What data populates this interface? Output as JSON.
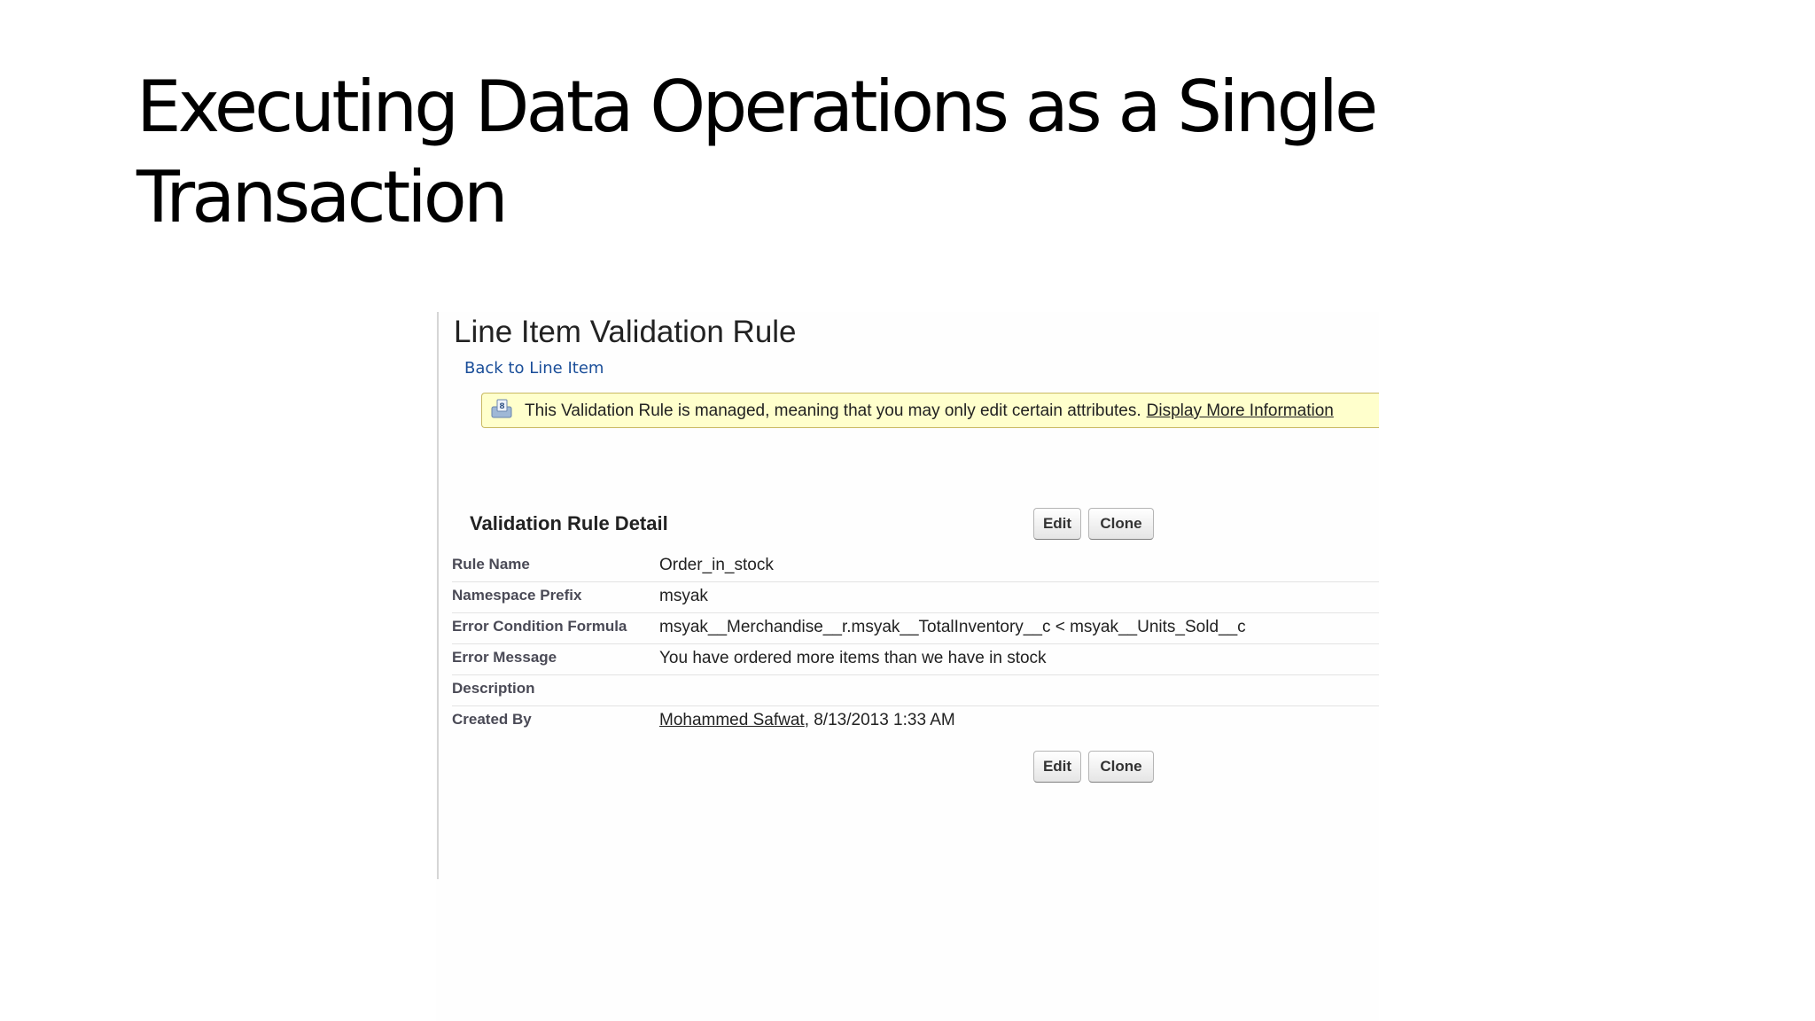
{
  "slide": {
    "title_line1": "Executing Data Operations as a Single",
    "title_line2": "Transaction"
  },
  "page": {
    "heading": "Line Item Validation Rule",
    "back_link": "Back to Line Item"
  },
  "banner": {
    "icon": "managed-package-info-icon",
    "text": "This Validation Rule is managed, meaning that you may only edit certain attributes.",
    "link": "Display More Information",
    "background": "#ffffcc"
  },
  "detail": {
    "section_title": "Validation Rule Detail",
    "edit_label": "Edit",
    "clone_label": "Clone",
    "rows": [
      {
        "label": "Rule Name",
        "value": "Order_in_stock"
      },
      {
        "label": "Namespace Prefix",
        "value": "msyak"
      },
      {
        "label": "Error Condition Formula",
        "value": "msyak__Merchandise__r.msyak__TotalInventory__c < msyak__Units_Sold__c"
      },
      {
        "label": "Error Message",
        "value": "You have ordered more items than we have in stock"
      },
      {
        "label": "Description",
        "value": ""
      },
      {
        "label": "Created By",
        "user": "Mohammed Safwat",
        "date": ", 8/13/2013 1:33 AM"
      }
    ]
  },
  "colors": {
    "link": "#1a4e99",
    "label": "#4a4a56"
  }
}
